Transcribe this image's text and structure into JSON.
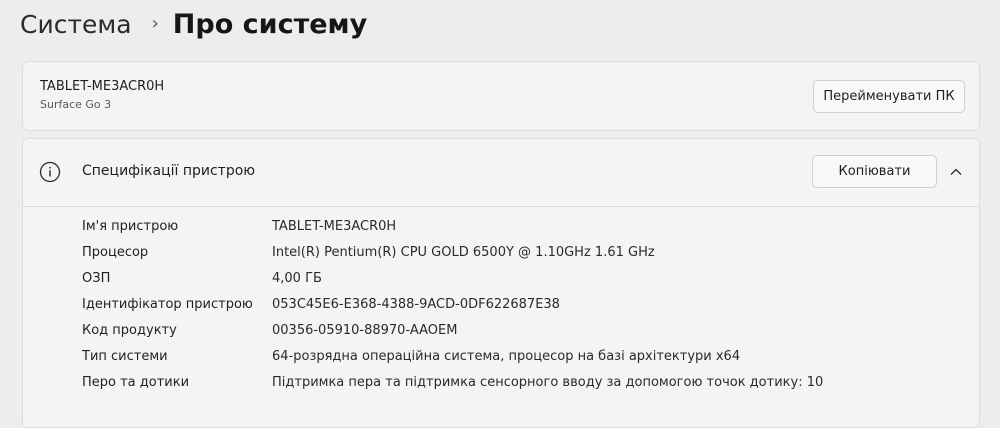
{
  "breadcrumb": {
    "parent": "Система",
    "separator": "›",
    "current": "Про систему"
  },
  "device": {
    "name": "TABLET-ME3ACR0H",
    "model": "Surface Go 3",
    "rename_button": "Перейменувати ПК"
  },
  "specs": {
    "title": "Специфікації пристрою",
    "copy_button": "Копіювати",
    "rows": [
      {
        "label": "Ім'я пристрою",
        "value": "TABLET-ME3ACR0H"
      },
      {
        "label": "Процесор",
        "value": "Intel(R) Pentium(R) CPU GOLD 6500Y @ 1.10GHz   1.61 GHz"
      },
      {
        "label": "ОЗП",
        "value": "4,00 ГБ"
      },
      {
        "label": "Ідентифікатор пристрою",
        "value": "053C45E6-E368-4388-9ACD-0DF622687E38"
      },
      {
        "label": "Код продукту",
        "value": "00356-05910-88970-AAOEM"
      },
      {
        "label": "Тип системи",
        "value": "64-розрядна операційна система, процесор на базі архітектури x64"
      },
      {
        "label": "Перо та дотики",
        "value": "Підтримка пера та підтримка сенсорного вводу за допомогою точок дотику: 10"
      }
    ]
  },
  "icons": {
    "info": "info-icon",
    "chevron": "chevron-up-icon"
  }
}
